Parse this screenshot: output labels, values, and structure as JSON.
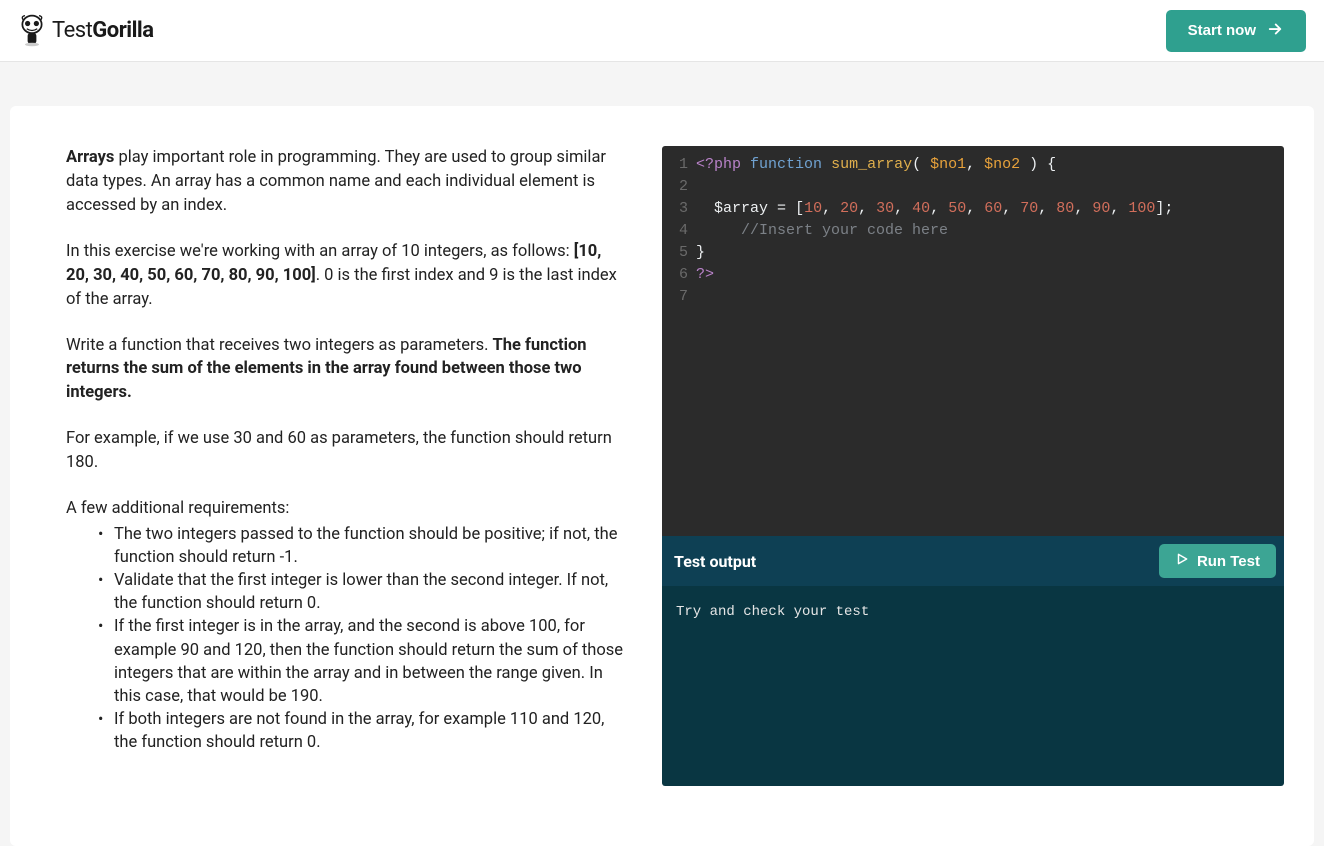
{
  "header": {
    "logo_text_light": "Test",
    "logo_text_bold": "Gorilla",
    "start_label": "Start now"
  },
  "problem": {
    "p1_lead": "Arrays",
    "p1_rest": " play important role in programming. They are used to group similar data types. An array has a common name and each individual element is accessed by an index.",
    "p2_before": "In this exercise we're working with an array of 10 integers, as follows: ",
    "p2_bold": "[10, 20, 30, 40, 50, 60, 70, 80, 90, 100]",
    "p2_after": ". 0 is the first index and 9 is the last index of the array.",
    "p3_before": "Write a function that receives two integers as parameters. ",
    "p3_bold": "The function returns the sum of the elements in the array found between those two integers.",
    "p4": "For example, if we use 30 and 60 as parameters, the function should return 180.",
    "p5": "A few additional requirements:",
    "bullets": [
      "The two integers passed to the function should be positive; if not, the function should return -1.",
      "Validate that the first integer is lower than the second integer. If not, the function should return 0.",
      "If the first integer is in the array, and the second is above 100, for example 90 and 120, then the function should return the sum of those integers that are within the array and in between the range given. In this case, that would be 190.",
      "If both integers are not found in the array, for example 110 and 120, the function should return 0."
    ]
  },
  "editor": {
    "lines": [
      {
        "n": "1",
        "tokens": [
          [
            "tag",
            "<?php"
          ],
          [
            "punc",
            " "
          ],
          [
            "kw",
            "function"
          ],
          [
            "punc",
            " "
          ],
          [
            "fn",
            "sum_array"
          ],
          [
            "punc",
            "( "
          ],
          [
            "par",
            "$no1"
          ],
          [
            "punc",
            ", "
          ],
          [
            "par",
            "$no2"
          ],
          [
            "punc",
            " ) {"
          ]
        ]
      },
      {
        "n": "2",
        "tokens": []
      },
      {
        "n": "3",
        "tokens": [
          [
            "punc",
            "  "
          ],
          [
            "var",
            "$array"
          ],
          [
            "punc",
            " "
          ],
          [
            "op",
            "="
          ],
          [
            "punc",
            " ["
          ],
          [
            "num",
            "10"
          ],
          [
            "punc",
            ", "
          ],
          [
            "num",
            "20"
          ],
          [
            "punc",
            ", "
          ],
          [
            "num",
            "30"
          ],
          [
            "punc",
            ", "
          ],
          [
            "num",
            "40"
          ],
          [
            "punc",
            ", "
          ],
          [
            "num",
            "50"
          ],
          [
            "punc",
            ", "
          ],
          [
            "num",
            "60"
          ],
          [
            "punc",
            ", "
          ],
          [
            "num",
            "70"
          ],
          [
            "punc",
            ", "
          ],
          [
            "num",
            "80"
          ],
          [
            "punc",
            ", "
          ],
          [
            "num",
            "90"
          ],
          [
            "punc",
            ", "
          ],
          [
            "num",
            "100"
          ],
          [
            "punc",
            "];"
          ]
        ]
      },
      {
        "n": "4",
        "tokens": [
          [
            "punc",
            "     "
          ],
          [
            "cmt",
            "//Insert your code here"
          ]
        ]
      },
      {
        "n": "5",
        "tokens": [
          [
            "punc",
            "}"
          ]
        ]
      },
      {
        "n": "6",
        "tokens": [
          [
            "tag",
            "?>"
          ]
        ]
      },
      {
        "n": "7",
        "tokens": []
      }
    ]
  },
  "output": {
    "title": "Test output",
    "run_label": "Run Test",
    "body": "Try and check your test"
  }
}
